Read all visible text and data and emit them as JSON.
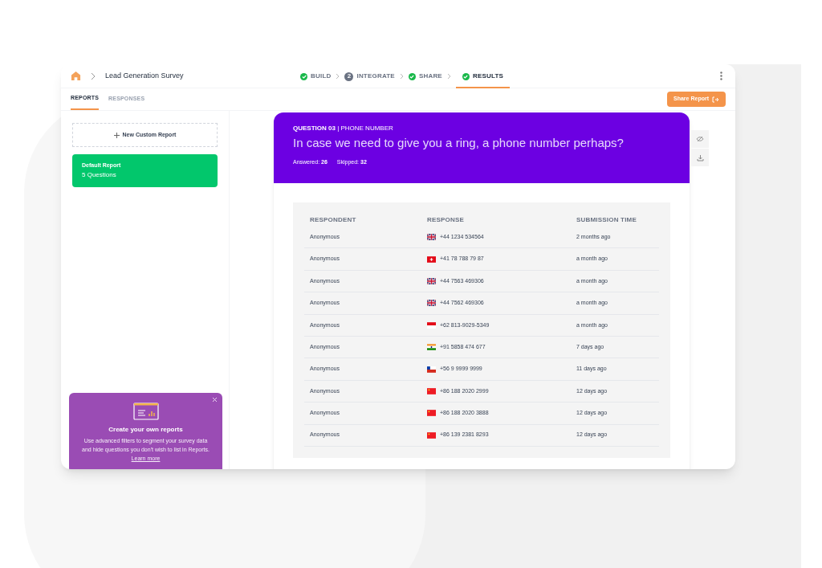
{
  "breadcrumb": {
    "title": "Lead Generation Survey"
  },
  "steps": [
    {
      "label": "BUILD",
      "completed": true,
      "selected": false
    },
    {
      "label": "INTEGRATE",
      "completed": false,
      "number": "2",
      "selected": false
    },
    {
      "label": "SHARE",
      "completed": true,
      "selected": false
    },
    {
      "label": "RESULTS",
      "completed": true,
      "selected": true
    }
  ],
  "tabs": [
    {
      "label": "REPORTS",
      "selected": true
    },
    {
      "label": "RESPONSES",
      "selected": false
    }
  ],
  "share_button": "Share Report",
  "sidebar": {
    "new_report": "New Custom Report",
    "reports": [
      {
        "title": "Default Report",
        "subtitle": "5 Questions",
        "selected": true
      }
    ]
  },
  "tip": {
    "title": "Create your own reports",
    "text": "Use advanced filters to segment your survey data and hide questions you don't wish to list in Reports.",
    "link": "Learn more"
  },
  "question": {
    "label": "**QUESTION 03** | PHONE NUMBER",
    "text": "In case we need to give you a ring, a phone number perhaps?",
    "answered_label": "Answered:",
    "answered": "26",
    "skipped_label": "Skipped:",
    "skipped": "32"
  },
  "table": {
    "columns": [
      "RESPONDENT",
      "RESPONSE",
      "SUBMISSION TIME"
    ],
    "rows": [
      {
        "respondent": "Anonymous",
        "kind": "uk",
        "response": "+44 1234 534564",
        "time": "2 months ago"
      },
      {
        "respondent": "Anonymous",
        "kind": "ch",
        "response": "+41 78 788 79 87",
        "time": "a month ago"
      },
      {
        "respondent": "Anonymous",
        "kind": "uk",
        "response": "+44 7563 469306",
        "time": "a month ago"
      },
      {
        "respondent": "Anonymous",
        "kind": "uk",
        "response": "+44 7562 469306",
        "time": "a month ago"
      },
      {
        "respondent": "Anonymous",
        "kind": "id",
        "response": "+62 813-9029-5349",
        "time": "a month ago"
      },
      {
        "respondent": "Anonymous",
        "kind": "in",
        "response": "+91 5858 474 677",
        "time": "7 days ago"
      },
      {
        "respondent": "Anonymous",
        "kind": "cl",
        "response": "+56 9 9999 9999",
        "time": "11 days ago"
      },
      {
        "respondent": "Anonymous",
        "kind": "cn",
        "response": "+86 188 2020 2999",
        "time": "12 days ago"
      },
      {
        "respondent": "Anonymous",
        "kind": "cn",
        "response": "+86 188 2020 3888",
        "time": "12 days ago"
      },
      {
        "respondent": "Anonymous",
        "kind": "cn",
        "response": "+86 139 2381 8293",
        "time": "12 days ago"
      }
    ]
  }
}
